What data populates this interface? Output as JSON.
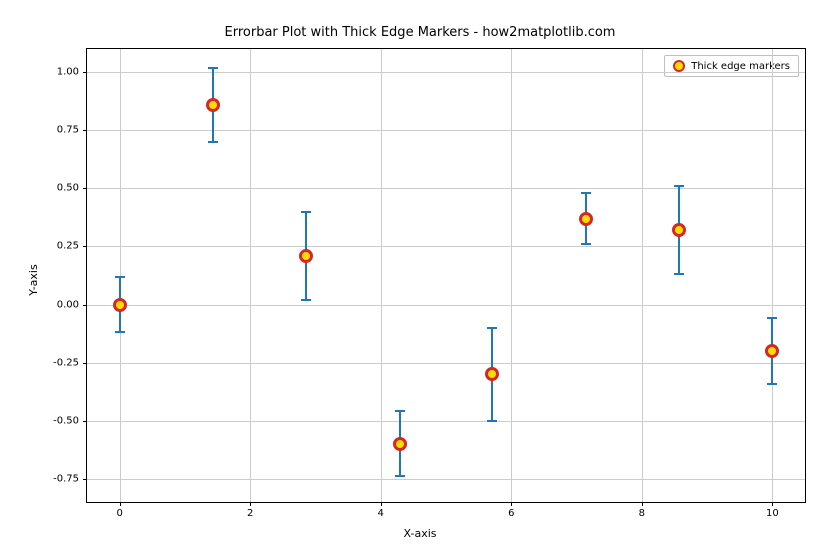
{
  "chart_data": {
    "type": "scatter",
    "title": "Errorbar Plot with Thick Edge Markers - how2matplotlib.com",
    "xlabel": "X-axis",
    "ylabel": "Y-axis",
    "xlim": [
      -0.5,
      10.5
    ],
    "ylim": [
      -0.85,
      1.1
    ],
    "xticks": [
      0,
      2,
      4,
      6,
      8,
      10
    ],
    "yticks": [
      -0.75,
      -0.5,
      -0.25,
      0.0,
      0.25,
      0.5,
      0.75,
      1.0
    ],
    "series": [
      {
        "name": "Thick edge markers",
        "x": [
          0.0,
          1.43,
          2.86,
          4.29,
          5.71,
          7.14,
          8.57,
          10.0
        ],
        "y": [
          0.0,
          0.86,
          0.21,
          -0.6,
          -0.3,
          0.37,
          0.32,
          -0.2
        ],
        "yerr": [
          0.12,
          0.16,
          0.19,
          0.14,
          0.2,
          0.11,
          0.19,
          0.14
        ]
      }
    ],
    "legend_position": "upper right",
    "grid": true,
    "marker_style": {
      "shape": "circle",
      "facecolor": "#ffdd00",
      "edgecolor": "#d62728",
      "edgewidth": 3
    },
    "errorbar_color": "#1f77b4"
  }
}
